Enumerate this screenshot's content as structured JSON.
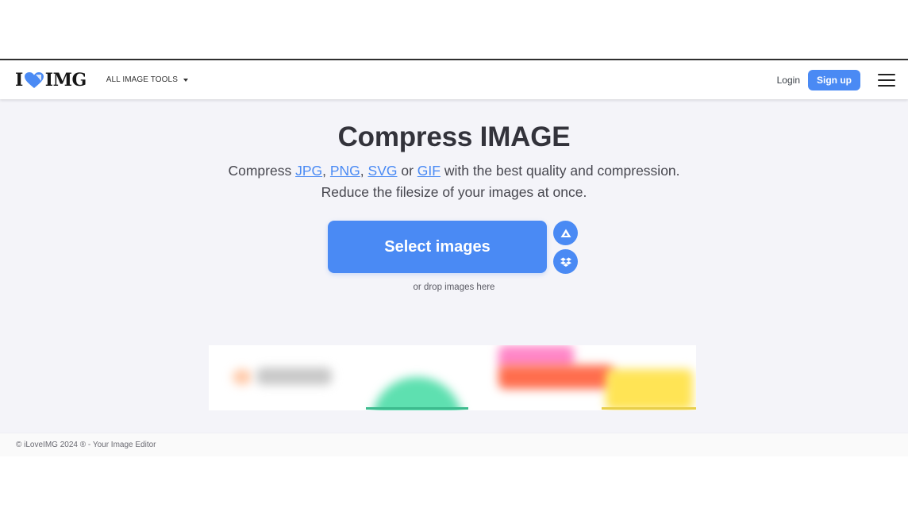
{
  "header": {
    "logo": {
      "left": "I",
      "right": "IMG",
      "icon": "heart-icon",
      "brand_color": "#4a8af4"
    },
    "tools_menu_label": "ALL IMAGE TOOLS",
    "login_label": "Login",
    "signup_label": "Sign up",
    "menu_icon": "hamburger-menu-icon"
  },
  "main": {
    "title": "Compress IMAGE",
    "subtitle": {
      "prefix": "Compress ",
      "formats": [
        "JPG",
        "PNG",
        "SVG",
        "GIF"
      ],
      "sep1": ", ",
      "sep2": ", ",
      "sep3": " or ",
      "suffix": " with the best quality and compression.",
      "line2": "Reduce the filesize of your images at once."
    },
    "select_button_label": "Select images",
    "cloud_buttons": [
      {
        "name": "google-drive",
        "icon": "google-drive-icon"
      },
      {
        "name": "dropbox",
        "icon": "dropbox-icon"
      }
    ],
    "drop_hint": "or drop images here",
    "accent_color": "#4a8af4"
  },
  "footer": {
    "copyright": "© iLoveIMG 2024 ® - Your Image Editor"
  }
}
